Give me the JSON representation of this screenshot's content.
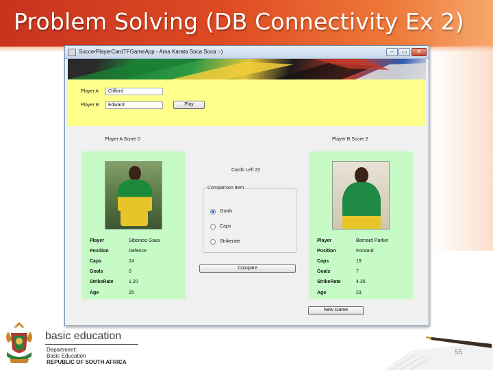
{
  "slide": {
    "title": "Problem Solving (DB Connectivity Ex 2)",
    "page_number": "55"
  },
  "window": {
    "title": "SoccerPlayerCardTFGameApp - Ama Karata Soca Soca :-)",
    "min_glyph": "–",
    "max_glyph": "▭",
    "close_glyph": "✕"
  },
  "form": {
    "player_a_label": "Player A",
    "player_a_value": "Clifford",
    "player_b_label": "Player B",
    "player_b_value": "Edward",
    "play_button": "Play"
  },
  "scores": {
    "player_a": "Player A Score 0",
    "player_b": "Player B Score 2"
  },
  "cards_left": "Cards Left 22",
  "comparison": {
    "title": "Comparison Item",
    "options": [
      {
        "label": "Goals",
        "checked": true
      },
      {
        "label": "Caps",
        "checked": false
      },
      {
        "label": "Strikerate",
        "checked": false
      }
    ],
    "compare_button": "Compare"
  },
  "card_a": {
    "rows": [
      {
        "key": "Player",
        "value": "Siboniso  Gaxa"
      },
      {
        "key": "Position",
        "value": "Defence"
      },
      {
        "key": "Caps",
        "value": "24"
      },
      {
        "key": "Goals",
        "value": "0"
      },
      {
        "key": "StrikeRate",
        "value": "1.20"
      },
      {
        "key": "Age",
        "value": "25"
      }
    ]
  },
  "card_b": {
    "rows": [
      {
        "key": "Player",
        "value": "Bernard  Parker"
      },
      {
        "key": "Position",
        "value": "Forward"
      },
      {
        "key": "Caps",
        "value": "19"
      },
      {
        "key": "Goals",
        "value": "7"
      },
      {
        "key": "StrikeRate",
        "value": "4.35"
      },
      {
        "key": "Age",
        "value": "23"
      }
    ]
  },
  "new_game_button": "New Game",
  "footer": {
    "main": "basic education",
    "line1": "Department:",
    "line2": "Basic Education",
    "line3": "REPUBLIC OF SOUTH AFRICA"
  },
  "colors": {
    "header": "#de4a23",
    "top_panel": "#ffff8c",
    "card": "#c6fbc6"
  }
}
